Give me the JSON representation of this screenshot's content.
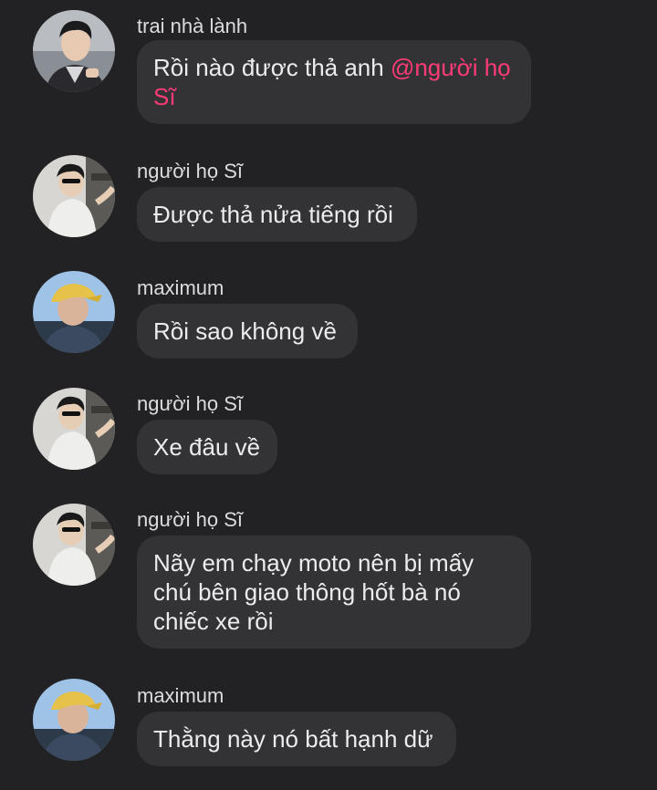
{
  "messages": [
    {
      "sender": "trai nhà lành",
      "text": "Rồi nào được thả anh ",
      "mention": "@người họ Sĩ",
      "avatar": "avatar-trai-nha-lanh"
    },
    {
      "sender": "người họ Sĩ",
      "text": "Được thả nửa tiếng rồi",
      "avatar": "avatar-nguoi-ho-si"
    },
    {
      "sender": "maximum",
      "text": "Rồi sao không về",
      "avatar": "avatar-maximum"
    },
    {
      "sender": "người họ Sĩ",
      "text": "Xe đâu về",
      "avatar": "avatar-nguoi-ho-si"
    },
    {
      "sender": "người họ Sĩ",
      "text": "Nãy em chạy moto nên bị mấy chú bên giao thông hốt bà nó chiếc xe rồi",
      "avatar": "avatar-nguoi-ho-si"
    },
    {
      "sender": "maximum",
      "text": "Thằng này nó bất hạnh dữ",
      "avatar": "avatar-maximum"
    }
  ],
  "colors": {
    "background": "#222224",
    "bubble": "#333336",
    "mention": "#ff3b77",
    "text": "#ececee"
  }
}
